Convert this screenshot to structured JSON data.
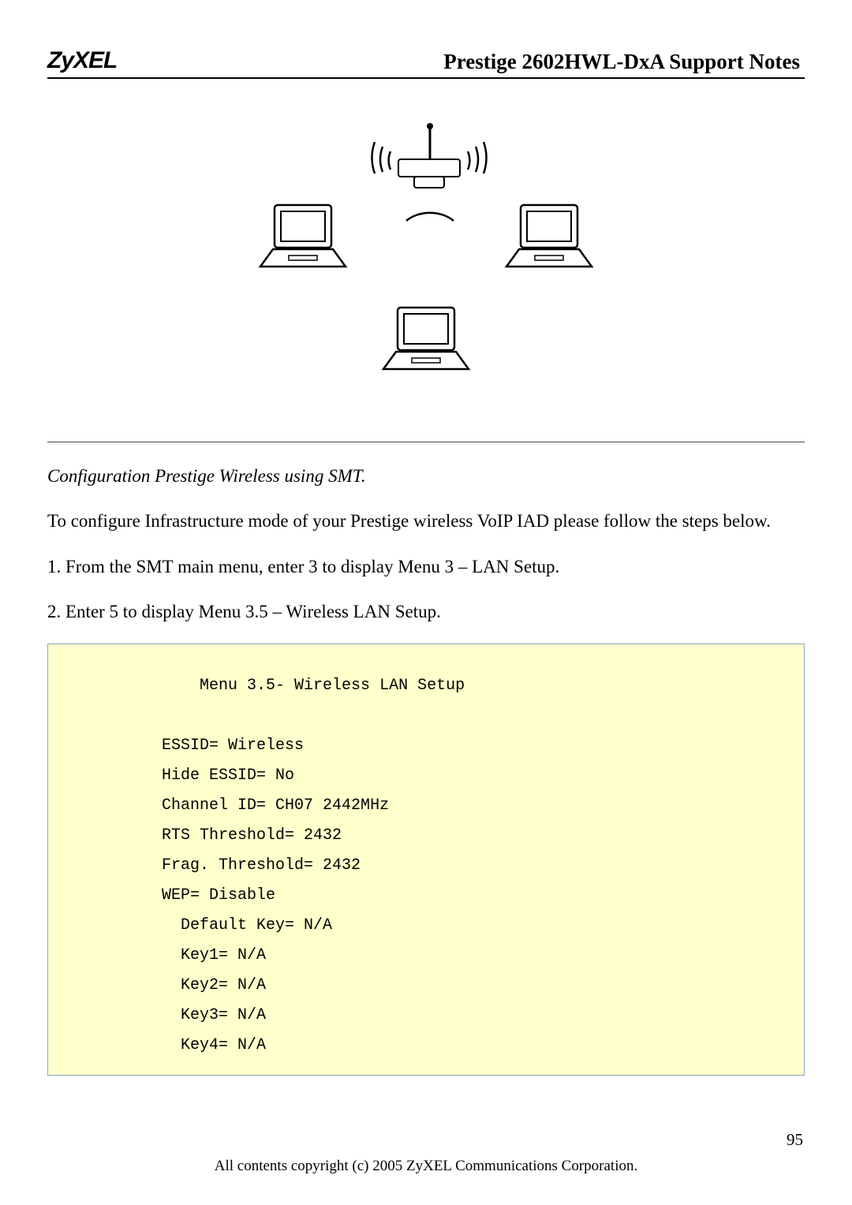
{
  "header": {
    "logo": "ZyXEL",
    "title": "Prestige 2602HWL-DxA Support Notes"
  },
  "section_heading": "Configuration Prestige Wireless using SMT.",
  "paragraphs": {
    "intro": "To configure Infrastructure mode of your Prestige wireless VoIP IAD please follow the steps below.",
    "step1": "1. From the SMT main menu, enter 3 to display Menu 3 – LAN Setup.",
    "step2": "2. Enter 5 to display Menu 3.5 – Wireless LAN Setup."
  },
  "terminal": "              Menu 3.5- Wireless LAN Setup\n\n          ESSID= Wireless\n          Hide ESSID= No\n          Channel ID= CH07 2442MHz\n          RTS Threshold= 2432\n          Frag. Threshold= 2432\n          WEP= Disable\n            Default Key= N/A\n            Key1= N/A\n            Key2= N/A\n            Key3= N/A\n            Key4= N/A",
  "page_number": "95",
  "footer": "All contents copyright (c) 2005 ZyXEL Communications Corporation."
}
